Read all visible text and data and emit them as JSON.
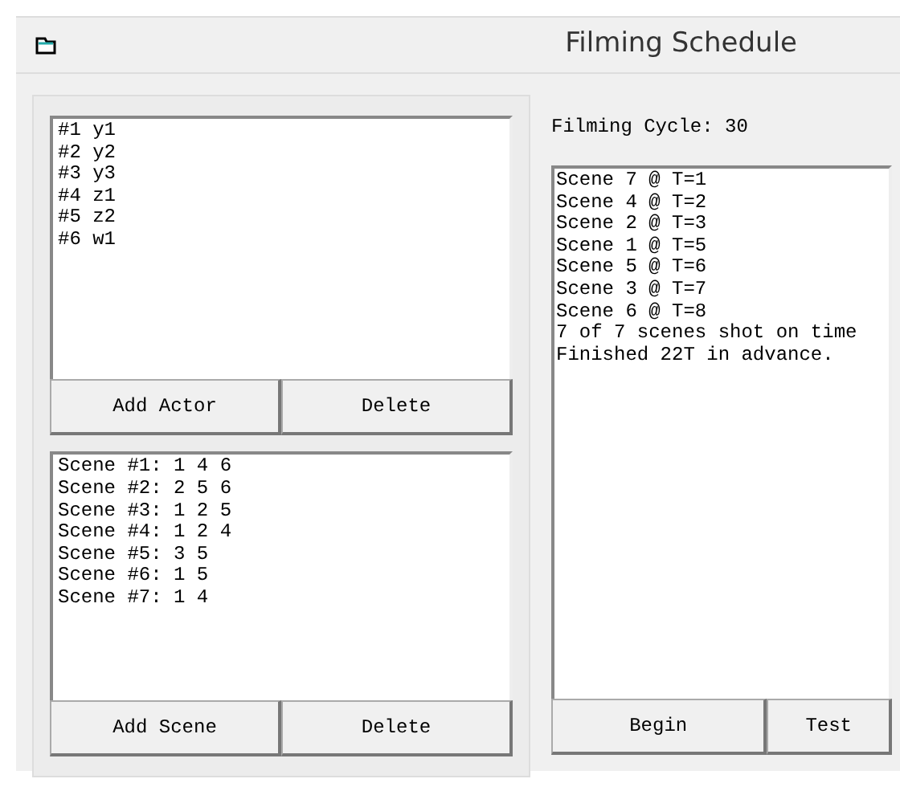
{
  "window": {
    "title": "Filming Schedule"
  },
  "actors": {
    "items": [
      "#1 y1",
      "#2 y2",
      "#3 y3",
      "#4 z1",
      "#5 z2",
      "#6 w1"
    ],
    "buttons": [
      "Add Actor",
      "Delete"
    ]
  },
  "scenes": {
    "items": [
      "Scene #1: 1 4 6",
      "Scene #2: 2 5 6",
      "Scene #3: 1 2 5",
      "Scene #4: 1 2 4",
      "Scene #5: 3 5",
      "Scene #6: 1 5",
      "Scene #7: 1 4"
    ],
    "buttons": [
      "Add Scene",
      "Delete"
    ]
  },
  "cycle_label": "Filming Cycle: 30",
  "output": {
    "lines": [
      "Scene 7 @ T=1",
      "Scene 4 @ T=2",
      "Scene 2 @ T=3",
      "Scene 1 @ T=5",
      "Scene 5 @ T=6",
      "Scene 3 @ T=7",
      "Scene 6 @ T=8",
      "7 of 7 scenes shot on time",
      "Finished 22T in advance."
    ],
    "buttons": [
      "Begin",
      "Test"
    ]
  }
}
